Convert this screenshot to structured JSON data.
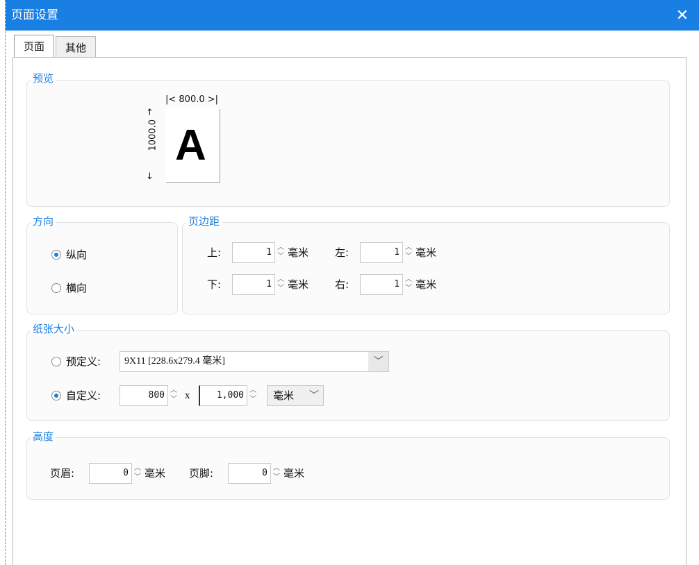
{
  "window": {
    "title": "页面设置",
    "close_glyph": "✕"
  },
  "tabs": [
    {
      "label": "页面"
    },
    {
      "label": "其他"
    }
  ],
  "preview": {
    "title": "预览",
    "width_label": "|< 800.0 >|",
    "height_label": "1000.0",
    "sample_letter": "A"
  },
  "orientation": {
    "title": "方向",
    "options": [
      {
        "label": "纵向",
        "selected": true
      },
      {
        "label": "横向",
        "selected": false
      }
    ]
  },
  "margins": {
    "title": "页边距",
    "top": {
      "label": "上:",
      "value": "1",
      "unit": "毫米"
    },
    "left": {
      "label": "左:",
      "value": "1",
      "unit": "毫米"
    },
    "bottom": {
      "label": "下:",
      "value": "1",
      "unit": "毫米"
    },
    "right": {
      "label": "右:",
      "value": "1",
      "unit": "毫米"
    }
  },
  "paper_size": {
    "title": "纸张大小",
    "predefined": {
      "label": "预定义:",
      "selected": false,
      "value": "9X11 [228.6x279.4 毫米]"
    },
    "custom": {
      "label": "自定义:",
      "selected": true,
      "width": "800",
      "separator": "x",
      "height": "1,000",
      "unit": "毫米"
    }
  },
  "height": {
    "title": "高度",
    "header": {
      "label": "页眉:",
      "value": "0",
      "unit": "毫米"
    },
    "footer": {
      "label": "页脚:",
      "value": "0",
      "unit": "毫米"
    }
  },
  "colors": {
    "accent": "#1a7fe3",
    "titlebar": "#1a7fe3",
    "group_title": "#1a7fe3"
  },
  "icons": {
    "close": "close-icon",
    "spin_up": "chevron-up-icon",
    "spin_down": "chevron-down-icon",
    "dropdown": "chevron-down-icon"
  }
}
